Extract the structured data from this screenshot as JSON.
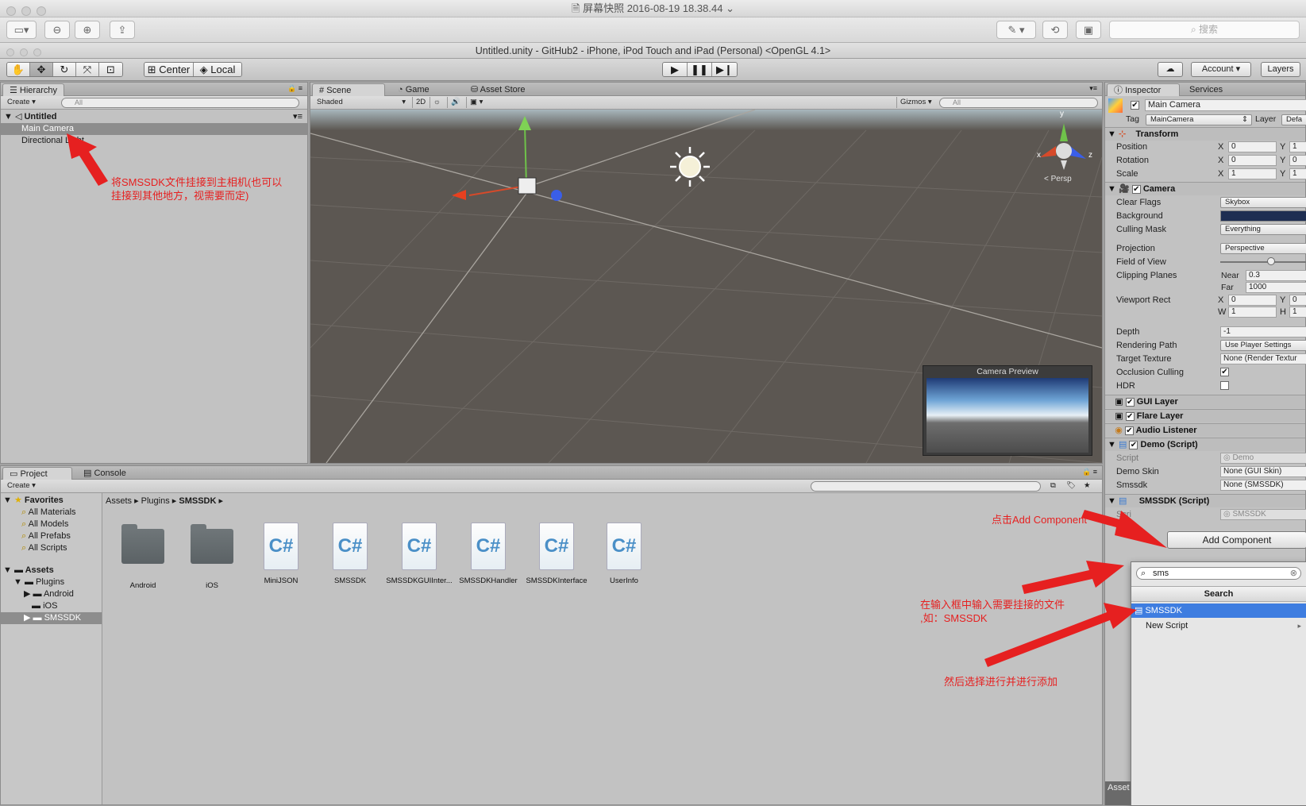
{
  "mac": {
    "window_title": "屏幕快照 2016-08-19 18.38.44",
    "search_placeholder": "搜索"
  },
  "unity": {
    "window_title": "Untitled.unity - GitHub2 - iPhone, iPod Touch and iPad (Personal) <OpenGL 4.1>",
    "toolbar": {
      "center": "Center",
      "local": "Local",
      "account": "Account",
      "layers": "Layers"
    }
  },
  "hierarchy": {
    "tab": "Hierarchy",
    "create": "Create",
    "search": "All",
    "scene_name": "Untitled",
    "items": [
      "Main Camera",
      "Directional Light"
    ]
  },
  "scene": {
    "tabs": [
      "Scene",
      "Game",
      "Asset Store"
    ],
    "shading": "Shaded",
    "mode_2d": "2D",
    "gizmos": "Gizmos",
    "search": "All",
    "persp": "Persp",
    "axis_x": "x",
    "axis_y": "y",
    "axis_z": "z",
    "camera_preview": "Camera Preview"
  },
  "project": {
    "tabs": [
      "Project",
      "Console"
    ],
    "create": "Create",
    "favorites_label": "Favorites",
    "favorites": [
      "All Materials",
      "All Models",
      "All Prefabs",
      "All Scripts"
    ],
    "assets_label": "Assets",
    "plugins_label": "Plugins",
    "plugin_children": [
      "Android",
      "iOS",
      "SMSSDK"
    ],
    "breadcrumb": [
      "Assets",
      "Plugins",
      "SMSSDK"
    ],
    "assets": [
      {
        "name": "Android",
        "kind": "folder"
      },
      {
        "name": "iOS",
        "kind": "folder"
      },
      {
        "name": "MiniJSON",
        "kind": "script"
      },
      {
        "name": "SMSSDK",
        "kind": "script"
      },
      {
        "name": "SMSSDKGUIInter...",
        "kind": "script"
      },
      {
        "name": "SMSSDKHandler",
        "kind": "script"
      },
      {
        "name": "SMSSDKInterface",
        "kind": "script"
      },
      {
        "name": "UserInfo",
        "kind": "script"
      }
    ],
    "script_glyph": "C#"
  },
  "inspector": {
    "tabs": [
      "Inspector",
      "Services"
    ],
    "object_name": "Main Camera",
    "tag_label": "Tag",
    "tag_value": "MainCamera",
    "layer_label": "Layer",
    "layer_value": "Defa",
    "transform": {
      "title": "Transform",
      "position": {
        "label": "Position",
        "x": "0",
        "y": "1"
      },
      "rotation": {
        "label": "Rotation",
        "x": "0",
        "y": "0"
      },
      "scale": {
        "label": "Scale",
        "x": "1",
        "y": "1"
      }
    },
    "camera": {
      "title": "Camera",
      "clear_flags": {
        "label": "Clear Flags",
        "value": "Skybox"
      },
      "background": {
        "label": "Background",
        "color": "#1e2e52"
      },
      "culling_mask": {
        "label": "Culling Mask",
        "value": "Everything"
      },
      "projection": {
        "label": "Projection",
        "value": "Perspective"
      },
      "fov": {
        "label": "Field of View",
        "level": 0.55
      },
      "clipping": {
        "label": "Clipping Planes",
        "near_label": "Near",
        "near": "0.3",
        "far_label": "Far",
        "far": "1000"
      },
      "viewport": {
        "label": "Viewport Rect",
        "x": "0",
        "y": "0",
        "w": "1",
        "h": "1"
      },
      "depth": {
        "label": "Depth",
        "value": "-1"
      },
      "rendering_path": {
        "label": "Rendering Path",
        "value": "Use Player Settings"
      },
      "target_texture": {
        "label": "Target Texture",
        "value": "None (Render Textur"
      },
      "occlusion": {
        "label": "Occlusion Culling",
        "checked": true
      },
      "hdr": {
        "label": "HDR",
        "checked": false
      }
    },
    "components": [
      "GUI Layer",
      "Flare Layer",
      "Audio Listener"
    ],
    "demo": {
      "title": "Demo (Script)",
      "script_label": "Script",
      "script_value": "Demo",
      "skin_label": "Demo Skin",
      "skin_value": "None (GUI Skin)",
      "smssdk_label": "Smssdk",
      "smssdk_value": "None (SMSSDK)"
    },
    "smssdk": {
      "title": "SMSSDK (Script)",
      "script_label": "Scri",
      "script_value": "SMSSDK"
    },
    "add_component": "Add Component",
    "popup": {
      "query": "sms",
      "header": "Search",
      "items": [
        "SMSSDK",
        "New Script"
      ]
    },
    "bottom_label": "Asset"
  },
  "annotations": {
    "hierarchy": "将SMSSDK文件挂接到主相机(也可以\n挂接到其他地方，视需要而定)",
    "add_component": "点击Add Component",
    "search_input": "在输入框中输入需要挂接的文件\n,如：SMSSDK",
    "select": "然后选择进行并进行添加"
  },
  "colors": {
    "annotation": "#e62020",
    "selection": "#3e7de0",
    "scene_bg": "#5c5752"
  }
}
